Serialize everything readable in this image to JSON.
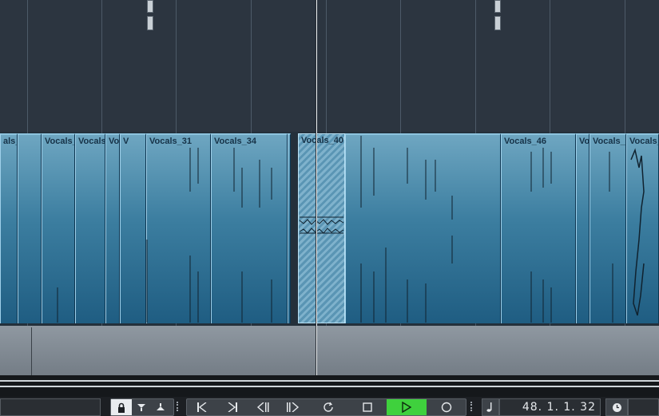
{
  "tracks": {
    "vocals_events": [
      {
        "label": "als_"
      },
      {
        "label": ""
      },
      {
        "label": "Vocals_"
      },
      {
        "label": "Vocals"
      },
      {
        "label": "Voc"
      },
      {
        "label": "V"
      },
      {
        "label": "Vocals_31"
      },
      {
        "label": "Vocals_34"
      },
      {
        "label": ""
      },
      {
        "label": "Vocals_40"
      },
      {
        "label": ""
      },
      {
        "label": "Vocals_46"
      },
      {
        "label": "Vo"
      },
      {
        "label": "Vocals_"
      },
      {
        "label": "Vocals_"
      }
    ]
  },
  "transport": {
    "lock_icon": "lock-icon",
    "position": "48.  1.  1. 32",
    "note_icon": "note-icon",
    "clock_icon": "clock-icon"
  },
  "colors": {
    "play_active": "#3fd13d",
    "event_blue": "#3c7ea0"
  }
}
